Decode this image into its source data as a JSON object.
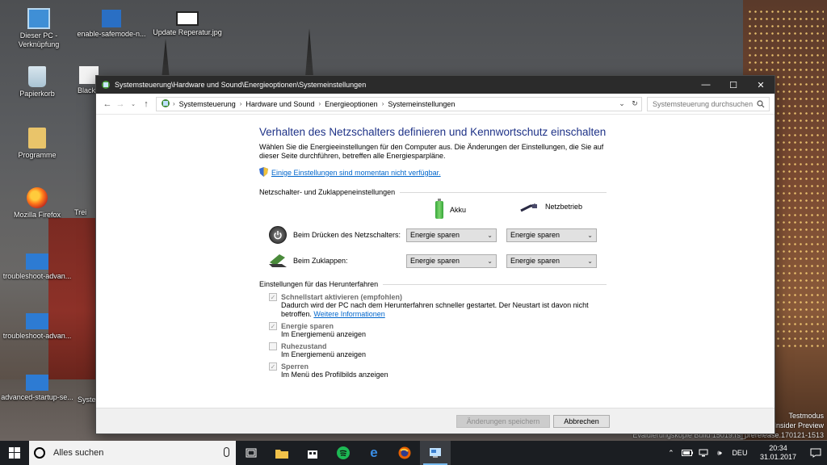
{
  "desktop": {
    "icons": [
      {
        "label": "Dieser PC - Verknüpfung"
      },
      {
        "label": "enable-safemode-n..."
      },
      {
        "label": "Update Reperatur.jpg"
      },
      {
        "label": "Papierkorb"
      },
      {
        "label": "Black"
      },
      {
        "label": "Programme"
      },
      {
        "label": "Mozilla Firefox"
      },
      {
        "label": "Trei"
      },
      {
        "label": "troubleshoot-advan..."
      },
      {
        "label": "troubleshoot-advan..."
      },
      {
        "label": "advanced-startup-se..."
      },
      {
        "label": "Syste"
      }
    ],
    "watermark": {
      "line1": "Testmodus",
      "line2": "Insider Preview",
      "line3": "Evaluierungskopie Build 15019.rs_prerelease.170121-1513"
    }
  },
  "window": {
    "title": "Systemsteuerung\\Hardware und Sound\\Energieoptionen\\Systemeinstellungen",
    "controls": {
      "minimize": "—",
      "maximize": "☐",
      "close": "✕"
    },
    "address": {
      "crumbs": [
        "Systemsteuerung",
        "Hardware und Sound",
        "Energieoptionen",
        "Systemeinstellungen"
      ],
      "search_placeholder": "Systemsteuerung durchsuchen"
    },
    "heading": "Verhalten des Netzschalters definieren und Kennwortschutz einschalten",
    "description": "Wählen Sie die Energieeinstellungen für den Computer aus. Die Änderungen der Einstellungen, die Sie auf dieser Seite durchführen, betreffen alle Energiesparpläne.",
    "unavailable_link": "Einige Einstellungen sind momentan nicht verfügbar.",
    "power_section": {
      "title": "Netzschalter- und Zuklappeneinstellungen",
      "col_battery": "Akku",
      "col_plugged": "Netzbetrieb",
      "rows": [
        {
          "label": "Beim Drücken des Netzschalters:",
          "battery": "Energie sparen",
          "plugged": "Energie sparen"
        },
        {
          "label": "Beim Zuklappen:",
          "battery": "Energie sparen",
          "plugged": "Energie sparen"
        }
      ]
    },
    "shutdown_section": {
      "title": "Einstellungen für das Herunterfahren",
      "items": [
        {
          "title": "Schnellstart aktivieren (empfohlen)",
          "checked": true,
          "desc": "Dadurch wird der PC nach dem Herunterfahren schneller gestartet. Der Neustart ist davon nicht betroffen.",
          "link": "Weitere Informationen"
        },
        {
          "title": "Energie sparen",
          "checked": true,
          "desc": "Im Energiemenü anzeigen"
        },
        {
          "title": "Ruhezustand",
          "checked": false,
          "desc": "Im Energiemenü anzeigen"
        },
        {
          "title": "Sperren",
          "checked": true,
          "desc": "Im Menü des Profilbilds anzeigen"
        }
      ]
    },
    "footer": {
      "save": "Änderungen speichern",
      "cancel": "Abbrechen"
    }
  },
  "taskbar": {
    "search_text": "Alles suchen",
    "language": "DEU",
    "time": "20:34",
    "date": "31.01.2017"
  }
}
